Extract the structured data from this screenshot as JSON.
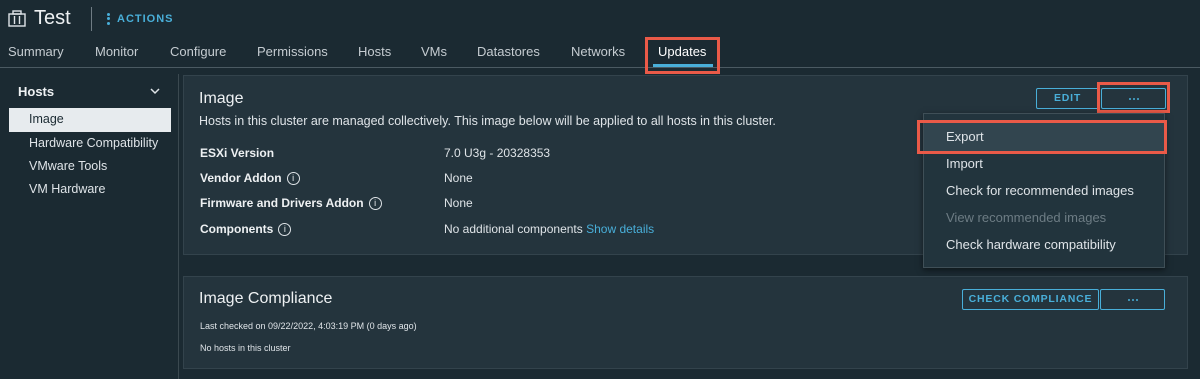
{
  "header": {
    "title": "Test",
    "actions_label": "ACTIONS"
  },
  "tabs": [
    {
      "label": "Summary"
    },
    {
      "label": "Monitor"
    },
    {
      "label": "Configure"
    },
    {
      "label": "Permissions"
    },
    {
      "label": "Hosts"
    },
    {
      "label": "VMs"
    },
    {
      "label": "Datastores"
    },
    {
      "label": "Networks"
    },
    {
      "label": "Updates"
    }
  ],
  "sidebar": {
    "heading": "Hosts",
    "items": [
      {
        "label": "Image"
      },
      {
        "label": "Hardware Compatibility"
      },
      {
        "label": "VMware Tools"
      },
      {
        "label": "VM Hardware"
      }
    ]
  },
  "image_panel": {
    "title": "Image",
    "description": "Hosts in this cluster are managed collectively. This image below will be applied to all hosts in this cluster.",
    "edit_label": "EDIT",
    "fields": [
      {
        "label": "ESXi Version",
        "value": "7.0 U3g - 20328353"
      },
      {
        "label": "Vendor Addon",
        "value": "None"
      },
      {
        "label": "Firmware and Drivers Addon",
        "value": "None"
      },
      {
        "label": "Components",
        "value": "No additional components",
        "link": "Show details"
      }
    ]
  },
  "dropdown": {
    "items": [
      {
        "label": "Export"
      },
      {
        "label": "Import"
      },
      {
        "label": "Check for recommended images"
      },
      {
        "label": "View recommended images"
      },
      {
        "label": "Check hardware compatibility"
      }
    ]
  },
  "compliance_panel": {
    "title": "Image Compliance",
    "check_label": "CHECK COMPLIANCE",
    "last_checked": "Last checked on 09/22/2022, 4:03:19 PM (0 days ago)",
    "status": "No hosts in this cluster"
  },
  "colors": {
    "accent": "#49afd9",
    "highlight": "#ea5a48",
    "background": "#1b2a32",
    "panel": "#24343d"
  }
}
